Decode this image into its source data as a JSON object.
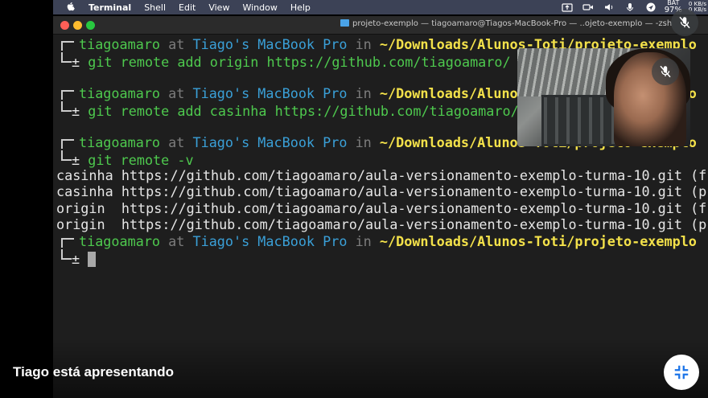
{
  "menubar": {
    "app_name": "Terminal",
    "menus": [
      "Shell",
      "Edit",
      "View",
      "Window",
      "Help"
    ],
    "battery": "97%",
    "battery_label": "BAT",
    "net_up": "0 KB/s",
    "net_down": "0 KB/s"
  },
  "window": {
    "title": "projeto-exemplo — tiagoamaro@Tiagos-MacBook-Pro — ..ojeto-exemplo — -zsh"
  },
  "prompt": {
    "user": "tiagoamaro",
    "at": "at",
    "host": "Tiago's MacBook Pro",
    "in": "in",
    "path": "~/Downloads/Alunos-Toti/projeto-exemplo",
    "symbol": "±"
  },
  "terminal": {
    "cmd1": "git remote add origin https://github.com/tiagoamaro/",
    "cmd2": "git remote add casinha https://github.com/tiagoamaro/",
    "cmd3": "git remote -v",
    "output": [
      {
        "remote": "casinha",
        "url": "https://github.com/tiagoamaro/aula-versionamento-exemplo-turma-10.git",
        "mode": "(f"
      },
      {
        "remote": "casinha",
        "url": "https://github.com/tiagoamaro/aula-versionamento-exemplo-turma-10.git",
        "mode": "(p"
      },
      {
        "remote": "origin ",
        "url": "https://github.com/tiagoamaro/aula-versionamento-exemplo-turma-10.git",
        "mode": "(f"
      },
      {
        "remote": "origin ",
        "url": "https://github.com/tiagoamaro/aula-versionamento-exemplo-turma-10.git",
        "mode": "(p"
      }
    ]
  },
  "meeting": {
    "presenting_label": "Tiago está apresentando"
  },
  "colors": {
    "user": "#4ec94e",
    "host": "#3aa0d8",
    "path": "#f3e14a",
    "menubar": "#3c4256"
  }
}
